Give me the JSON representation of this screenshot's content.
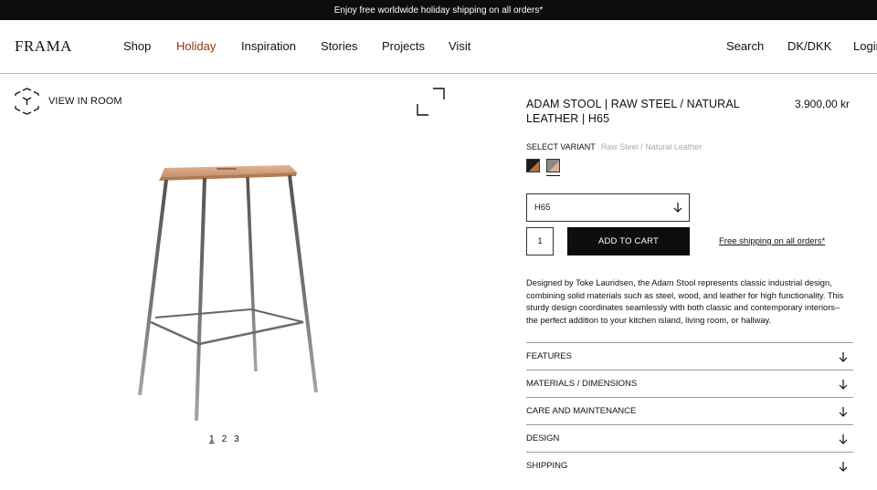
{
  "promo": {
    "text": "Enjoy free worldwide holiday shipping on all orders*"
  },
  "header": {
    "logo": "FRAMA",
    "nav": [
      "Shop",
      "Holiday",
      "Inspiration",
      "Stories",
      "Projects",
      "Visit"
    ],
    "utility": [
      "Search",
      "DK/DKK",
      "Login"
    ],
    "accent_color": "#8a3a18"
  },
  "gallery": {
    "view_in_room": "VIEW IN ROOM",
    "pages": [
      "1",
      "2",
      "3"
    ],
    "active_page": "1"
  },
  "product": {
    "title": "ADAM STOOL | RAW STEEL / NATURAL LEATHER | H65",
    "price": "3.900,00 kr",
    "variant_label": "SELECT VARIANT",
    "variant_value": "Raw Steel / Natural Leather",
    "size_value": "H65",
    "quantity": "1",
    "add_to_cart": "ADD TO CART",
    "shipping_link": "Free shipping on all orders*",
    "description": "Designed by Toke Lauridsen, the Adam Stool represents classic industrial design, combining solid materials such as steel, wood, and leather for high functionality. This sturdy design coordinates seamlessly with both classic and contemporary interiors– the perfect addition to your kitchen island, living room, or hallway.",
    "accordion": [
      "FEATURES",
      "MATERIALS / DIMENSIONS",
      "CARE AND MAINTENANCE",
      "DESIGN",
      "SHIPPING"
    ]
  }
}
